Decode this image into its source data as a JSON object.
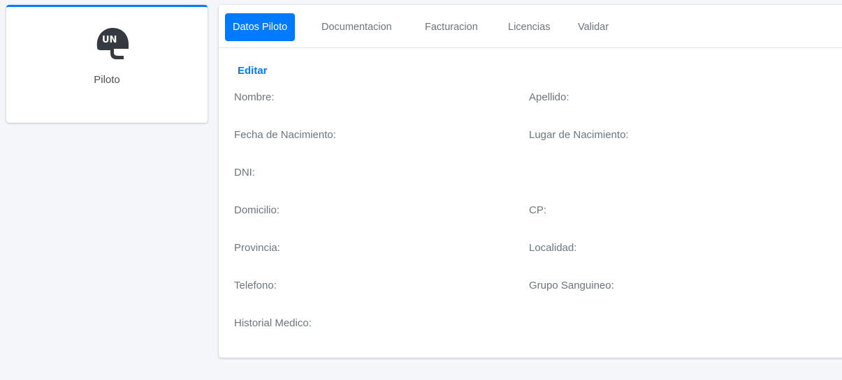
{
  "profile": {
    "icon": "helmet-un-icon",
    "icon_text": "UN",
    "name": "Piloto"
  },
  "tabs": [
    {
      "label": "Datos Piloto",
      "active": true
    },
    {
      "label": "Documentacion",
      "active": false
    },
    {
      "label": "Facturacion",
      "active": false
    },
    {
      "label": "Licencias",
      "active": false
    },
    {
      "label": "Validar",
      "active": false
    }
  ],
  "form": {
    "edit_label": "Editar",
    "fields": {
      "nombre": "Nombre:",
      "apellido": "Apellido:",
      "fecha_nacimiento": "Fecha de Nacimiento:",
      "lugar_nacimiento": "Lugar de Nacimiento:",
      "dni": "DNI:",
      "domicilio": "Domicilio:",
      "cp": "CP:",
      "provincia": "Provincia:",
      "localidad": "Localidad:",
      "telefono": "Telefono:",
      "grupo_sanguineo": "Grupo Sanguineo:",
      "historial_medico": "Historial Medico:"
    }
  },
  "colors": {
    "accent": "#007bff",
    "background": "#f4f6f9",
    "text_muted": "#6c757d"
  }
}
